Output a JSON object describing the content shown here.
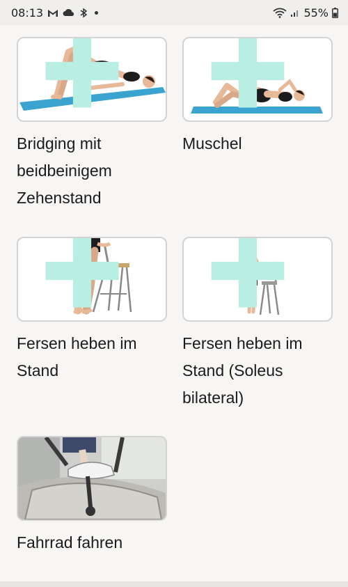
{
  "status_bar": {
    "time": "08:13",
    "battery": "55%",
    "icons_left": [
      "gmail-icon",
      "cloud-icon",
      "bluetooth-icon",
      "notification-dot"
    ],
    "icons_right": [
      "wifi-icon",
      "signal-icon",
      "battery-icon"
    ]
  },
  "exercises": [
    {
      "title": "Bridging mit beidbeinigem Zehenstand",
      "image": "bridging-exercise-image"
    },
    {
      "title": "Muschel",
      "image": "clamshell-exercise-image"
    },
    {
      "title": "Fersen heben im Stand",
      "image": "heel-raise-exercise-image"
    },
    {
      "title": "Fersen heben im Stand (Soleus bilateral)",
      "image": "heel-raise-soleus-exercise-image"
    },
    {
      "title": "Fahrrad fahren",
      "image": "cycling-exercise-image"
    }
  ],
  "colors": {
    "mat": "#3aa3d0",
    "plus": "#b9eee3",
    "background": "#f7f6f4",
    "card_border": "#d3d3d3"
  }
}
